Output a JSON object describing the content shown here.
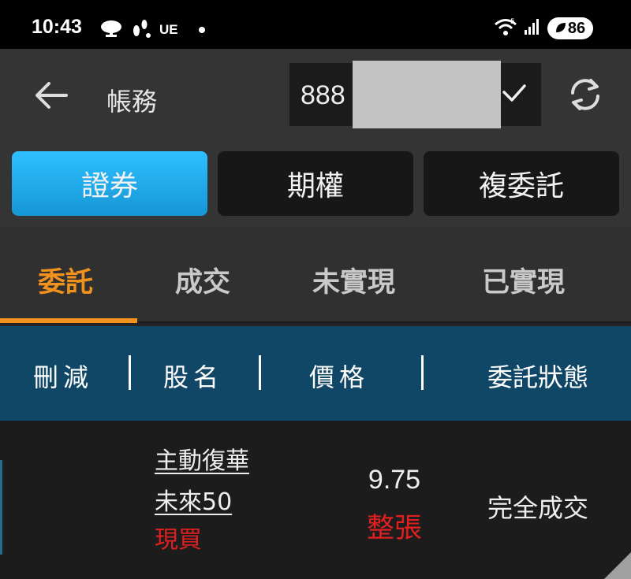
{
  "status_bar": {
    "time": "10:43",
    "carrier": "UE",
    "battery": "86"
  },
  "header": {
    "title": "帳務",
    "account_number_visible": "888"
  },
  "segments": [
    {
      "label": "證券",
      "active": true
    },
    {
      "label": "期權",
      "active": false
    },
    {
      "label": "複委託",
      "active": false
    }
  ],
  "subtabs": [
    {
      "label": "委託",
      "active": true
    },
    {
      "label": "成交",
      "active": false
    },
    {
      "label": "未實現",
      "active": false
    },
    {
      "label": "已實現",
      "active": false
    }
  ],
  "table": {
    "columns": [
      "刪減",
      "股名",
      "價格",
      "委託狀態"
    ],
    "rows": [
      {
        "stock_name_line1": "主動復華",
        "stock_name_line2": "未來50",
        "order_type": "現買",
        "price": "9.75",
        "lot_type": "整張",
        "status": "完全成交"
      }
    ]
  },
  "colors": {
    "accent_orange": "#f0921d",
    "active_blue": "#1fa8ea",
    "table_header_blue": "#104766",
    "buy_red": "#e02020"
  }
}
